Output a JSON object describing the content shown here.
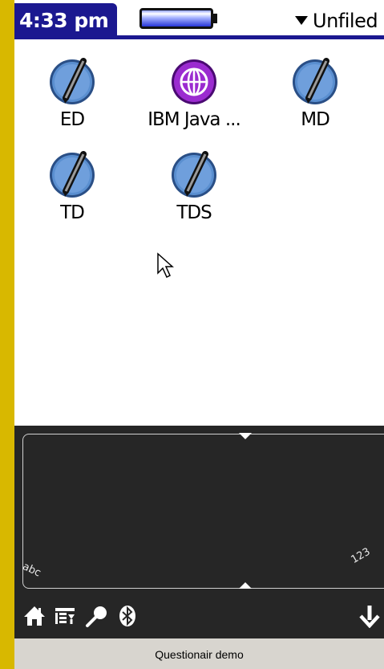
{
  "statusbar": {
    "time": "4:33 pm",
    "category": "Unfiled"
  },
  "apps": [
    {
      "label": "ED",
      "icon": "pen-icon"
    },
    {
      "label": "IBM Java ...",
      "icon": "globe-icon"
    },
    {
      "label": "MD",
      "icon": "pen-icon"
    },
    {
      "label": "TD",
      "icon": "pen-icon"
    },
    {
      "label": "TDS",
      "icon": "pen-icon"
    }
  ],
  "graffiti": {
    "letters_hint": "abc",
    "numbers_hint": "123"
  },
  "toolbar": {
    "icons": [
      "home-icon",
      "menu-icon",
      "find-icon",
      "bluetooth-icon",
      "down-arrow-icon"
    ]
  },
  "footer": {
    "label": "Questionair demo"
  },
  "colors": {
    "titlebar": "#1b1890",
    "graffiti_bg": "#262626",
    "frame": "#d8b800",
    "globe": "#9b2bd0",
    "pen_circle": "#5a8fd0"
  }
}
